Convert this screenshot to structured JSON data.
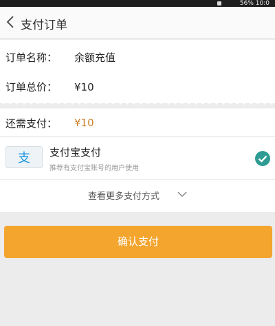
{
  "status_bar": {
    "text": "56% 10:0"
  },
  "header": {
    "title": "支付订单"
  },
  "order": {
    "name_label": "订单名称：",
    "name_value": "余额充值",
    "price_label": "订单总价：",
    "price_value": "¥10"
  },
  "due": {
    "label": "还需支付：",
    "amount": "¥10"
  },
  "payment_method": {
    "name": "支付宝支付",
    "description": "推荐有支付宝账号的用户使用",
    "logo_char": "支",
    "selected": true
  },
  "more_methods": {
    "label": "查看更多支付方式"
  },
  "confirm": {
    "label": "确认支付"
  },
  "colors": {
    "accent": "#f3a52e",
    "price": "#c9802a",
    "check": "#2e9c93",
    "alipay_blue": "#1a96e0"
  }
}
